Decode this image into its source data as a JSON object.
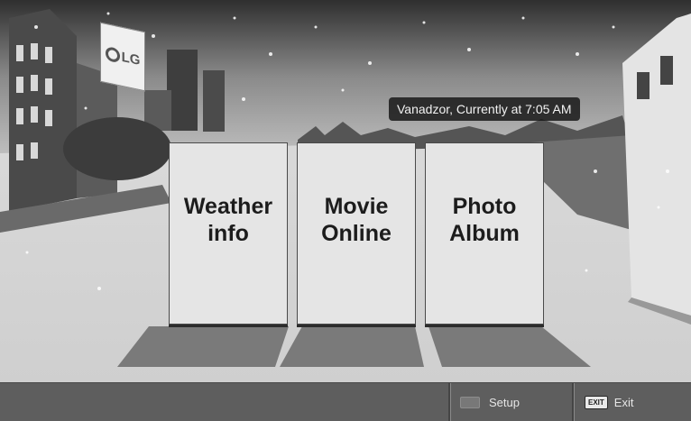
{
  "header": {
    "location_status": "Vanadzor, Currently at 7:05 AM",
    "logo_text": "LG"
  },
  "cards": [
    {
      "label_line1": "Weather",
      "label_line2": "info"
    },
    {
      "label_line1": "Movie",
      "label_line2": "Online"
    },
    {
      "label_line1": "Photo",
      "label_line2": "Album"
    }
  ],
  "bottom_bar": {
    "setup_label": "Setup",
    "exit_key_label": "EXIT",
    "exit_label": "Exit"
  }
}
